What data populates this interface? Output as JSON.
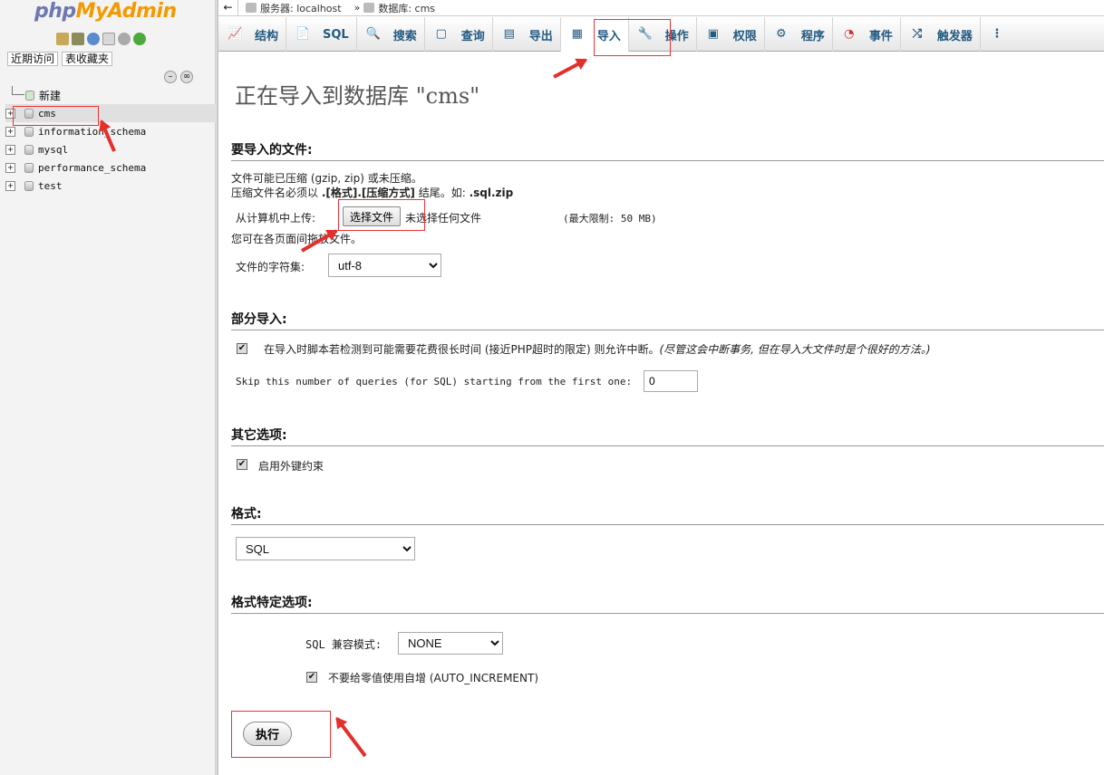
{
  "logo": {
    "part1": "php",
    "part2": "MyAdmin"
  },
  "sidebar": {
    "tabs": [
      "近期访问",
      "表收藏夹"
    ],
    "new_label": "新建",
    "databases": [
      "cms",
      "information_schema",
      "mysql",
      "performance_schema",
      "test"
    ],
    "selected": "cms"
  },
  "breadcrumb": {
    "back": "←",
    "server": "服务器: localhost",
    "sep": "»",
    "database": "数据库: cms"
  },
  "menu": {
    "tabs": [
      {
        "label": "结构",
        "icon": "structure-icon"
      },
      {
        "label": "SQL",
        "icon": "sql-icon"
      },
      {
        "label": "搜索",
        "icon": "search-icon"
      },
      {
        "label": "查询",
        "icon": "query-icon"
      },
      {
        "label": "导出",
        "icon": "export-icon"
      },
      {
        "label": "导入",
        "icon": "import-icon"
      },
      {
        "label": "操作",
        "icon": "wrench-icon"
      },
      {
        "label": "权限",
        "icon": "privileges-icon"
      },
      {
        "label": "程序",
        "icon": "routines-icon"
      },
      {
        "label": "事件",
        "icon": "clock-icon"
      },
      {
        "label": "触发器",
        "icon": "triggers-icon"
      }
    ],
    "active": "导入"
  },
  "page": {
    "title": "正在导入到数据库 \"cms\"",
    "file_section": {
      "heading": "要导入的文件:",
      "line1": "文件可能已压缩 (gzip, zip) 或未压缩。",
      "line2_prefix": "压缩文件名必须以 ",
      "line2_bold": ".[格式].[压缩方式]",
      "line2_mid": " 结尾。如: ",
      "line2_example": ".sql.zip",
      "upload_label": "从计算机中上传:",
      "choose_button": "选择文件",
      "no_file": "未选择任何文件",
      "max_limit": "(最大限制: 50 MB)",
      "drag_hint": "您可在各页面间拖放文件。",
      "charset_label": "文件的字符集:",
      "charset_value": "utf-8"
    },
    "partial_section": {
      "heading": "部分导入:",
      "allow_interrupt": "在导入时脚本若检测到可能需要花费很长时间 (接近PHP超时的限定) 则允许中断。",
      "allow_interrupt_note": "(尽管这会中断事务, 但在导入大文件时是个很好的方法。)",
      "skip_label": "Skip this number of queries (for SQL) starting from the first one:",
      "skip_value": "0"
    },
    "other_section": {
      "heading": "其它选项:",
      "fk_label": "启用外键约束"
    },
    "format_section": {
      "heading": "格式:",
      "format_value": "SQL"
    },
    "format_opts_section": {
      "heading": "格式特定选项:",
      "compat_label": "SQL 兼容模式:",
      "compat_value": "NONE",
      "no_auto_label": "不要给零值使用自增 (AUTO_INCREMENT)"
    },
    "go_button": "执行"
  },
  "colors": {
    "annotation_red": "#e42f2a",
    "link_blue": "#235a81",
    "logo_blue": "#6c78af",
    "logo_orange": "#f29a00"
  }
}
